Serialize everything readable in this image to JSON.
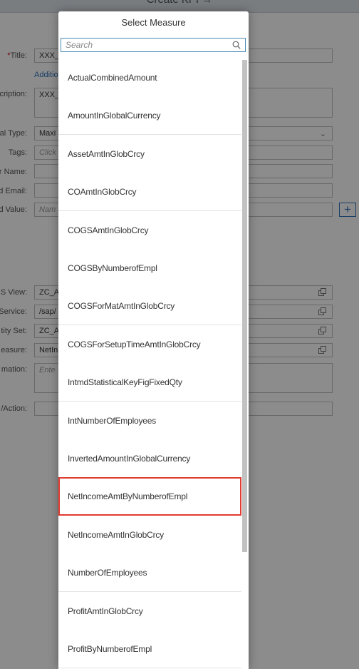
{
  "background": {
    "header_title": "Create KPI →",
    "additional_link": "Additional",
    "labels": {
      "title": "Title:",
      "title_required_mark": "*",
      "description": "cription:",
      "goal_type": "al Type:",
      "tags": "Tags:",
      "owner_name": "r Name:",
      "owner_email": "d Email:",
      "additional_value": "d Value:",
      "odata_view": "S View:",
      "service": "Service:",
      "entity_set": "tity Set:",
      "measure": "easure:",
      "information": "mation:",
      "action": "/Action:"
    },
    "values": {
      "title": "XXX_",
      "description": "XXX_",
      "goal_type": "Maxi",
      "tags_placeholder": "Click",
      "additional_value_placeholder": "Nam",
      "odata_view": "ZC_A",
      "service": "/sap/",
      "entity_set": "ZC_A",
      "measure": "NetIn",
      "information_placeholder": "Ente"
    },
    "add_button": "+"
  },
  "dialog": {
    "title": "Select Measure",
    "search_placeholder": "Search",
    "selected_index": 11,
    "items": [
      "ActualCombinedAmount",
      "AmountInGlobalCurrency",
      "AssetAmtInGlobCrcy",
      "COAmtInGlobCrcy",
      "COGSAmtInGlobCrcy",
      "COGSByNumberofEmpl",
      "COGSForMatAmtInGlobCrcy",
      "COGSForSetupTimeAmtInGlobCrcy",
      "IntmdStatisticalKeyFigFixedQty",
      "IntNumberOfEmployees",
      "InvertedAmountInGlobalCurrency",
      "NetIncomeAmtByNumberofEmpl",
      "NetIncomeAmtInGlobCrcy",
      "NumberOfEmployees",
      "ProfitAmtInGlobCrcy",
      "ProfitByNumberofEmpl"
    ]
  },
  "colors": {
    "selection_border": "#e03c31",
    "link": "#2a6fb8",
    "required": "#d0021b"
  }
}
